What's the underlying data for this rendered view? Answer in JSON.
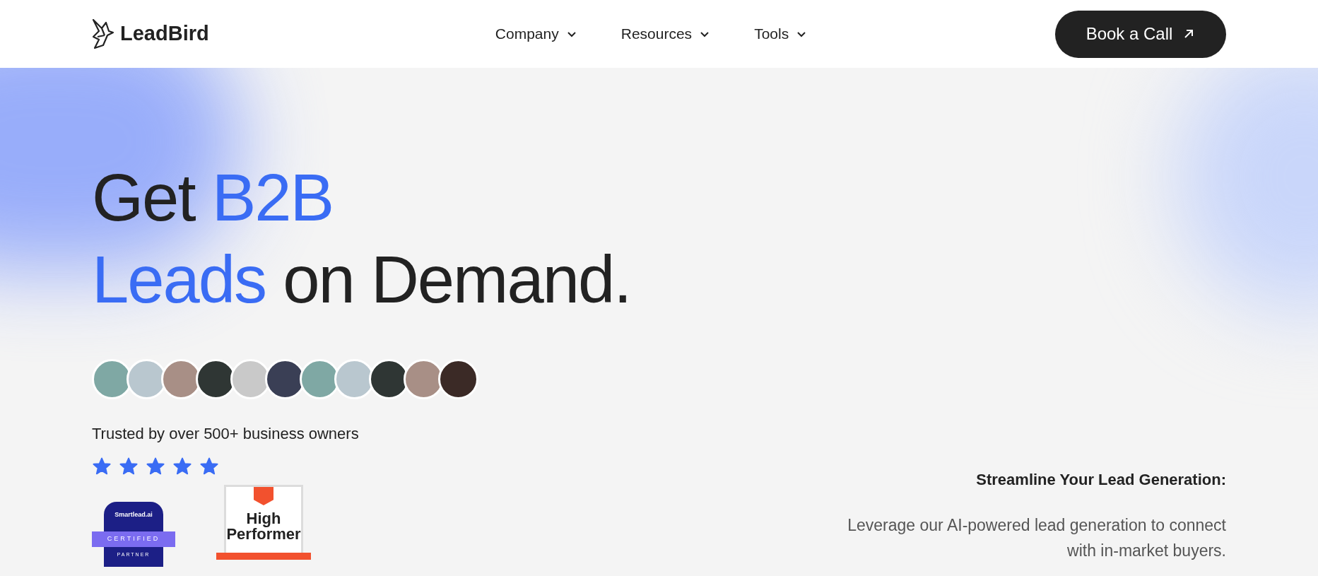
{
  "header": {
    "logo": "LeadBird",
    "nav": [
      {
        "label": "Company"
      },
      {
        "label": "Resources"
      },
      {
        "label": "Tools"
      }
    ],
    "cta": "Book a Call"
  },
  "hero": {
    "headline": [
      [
        {
          "text": "Get ",
          "highlight": false
        },
        {
          "text": "B2B",
          "highlight": true
        }
      ],
      [
        {
          "text": "Leads",
          "highlight": true
        },
        {
          "text": " on Demand.",
          "highlight": false
        }
      ]
    ],
    "trusted": "Trusted by over 500+ business owners",
    "rating": {
      "stars": 5
    },
    "badges": [
      {
        "kind": "smartlead",
        "title": "Smartlead.ai",
        "ribbon": "CERTIFIED",
        "caption": "PARTNER"
      },
      {
        "kind": "g2",
        "title": "High Performer"
      }
    ],
    "aside": {
      "heading": "Streamline Your Lead Generation:",
      "text": "Leverage our AI-powered lead generation to connect with in-market buyers."
    }
  }
}
